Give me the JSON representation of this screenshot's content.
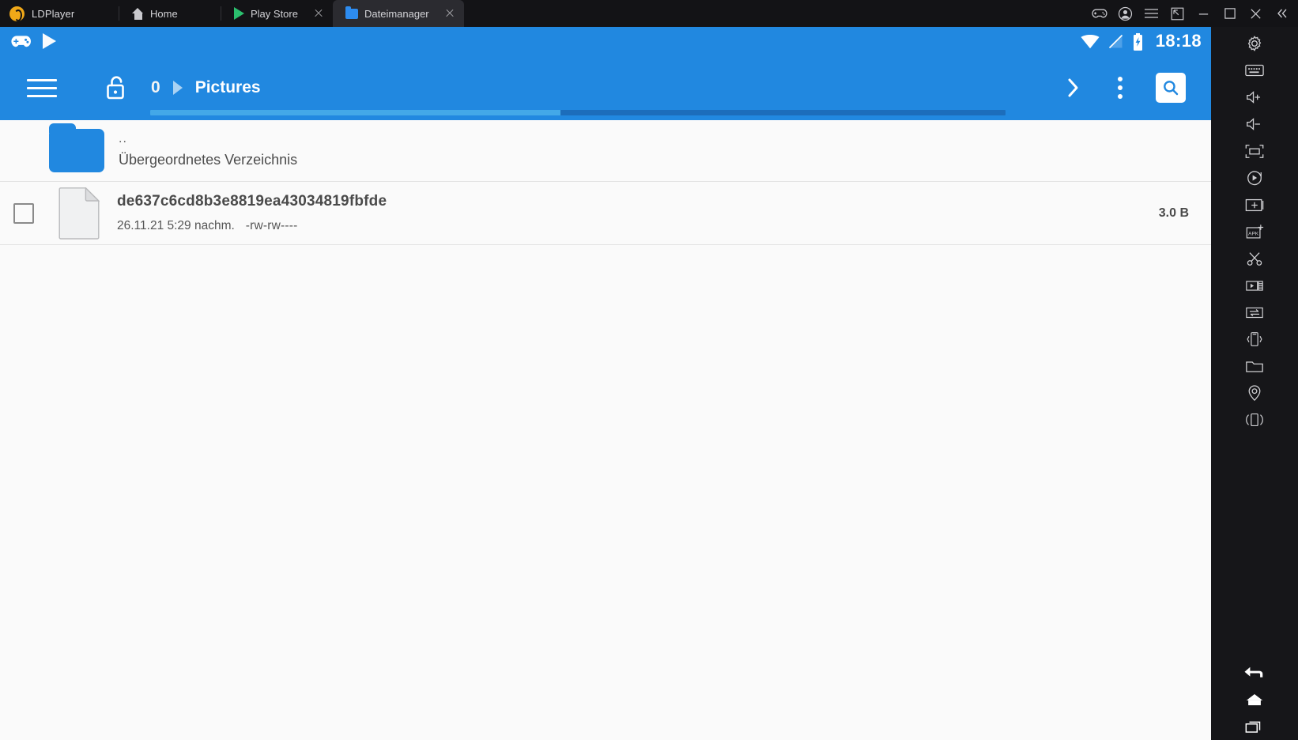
{
  "titlebar": {
    "brand": "LDPlayer",
    "tabs": [
      {
        "label": "Home",
        "icon": "home-icon",
        "closable": false,
        "active": false
      },
      {
        "label": "Play Store",
        "icon": "play-store-icon",
        "closable": true,
        "active": false
      },
      {
        "label": "Dateimanager",
        "icon": "file-manager-icon",
        "closable": true,
        "active": true
      }
    ],
    "controls": [
      {
        "name": "gamepad-icon",
        "label": "Gamepad"
      },
      {
        "name": "account-icon",
        "label": "Account"
      },
      {
        "name": "menu-icon",
        "label": "Menu"
      },
      {
        "name": "resize-icon",
        "label": "Resize"
      },
      {
        "name": "minimize-icon",
        "label": "Minimize"
      },
      {
        "name": "maximize-icon",
        "label": "Maximize"
      },
      {
        "name": "close-icon",
        "label": "Close"
      },
      {
        "name": "collapse-icon",
        "label": "Collapse"
      }
    ]
  },
  "statusbar": {
    "time": "18:18",
    "left_icons": [
      "gamepad-icon",
      "play-store-icon"
    ],
    "right_icons": [
      "wifi-icon",
      "no-signal-icon",
      "battery-charging-icon"
    ]
  },
  "appbar": {
    "menu_label": "Menu",
    "lock_label": "Unlock",
    "breadcrumbs": [
      {
        "label": "0"
      },
      {
        "label": "Pictures"
      }
    ],
    "actions": [
      {
        "name": "chevron-right-icon",
        "label": "Forward"
      },
      {
        "name": "overflow-menu-icon",
        "label": "More options"
      },
      {
        "name": "search-icon",
        "label": "Search"
      }
    ],
    "progress_percent": 48,
    "accent_color": "#2188e0",
    "progress_track_color": "#1c6dbb",
    "progress_fill_color": "#43a8e8"
  },
  "list": {
    "parent_row": {
      "title": "..",
      "subtitle": "Übergeordnetes Verzeichnis"
    },
    "files": [
      {
        "name": "de637c6cd8b3e8819ea43034819fbfde",
        "date": "26.11.21 5:29 nachm.",
        "permissions": "-rw-rw----",
        "size": "3.0 B",
        "selected": false
      }
    ]
  },
  "sidebar": {
    "items": [
      {
        "name": "settings-gear-icon",
        "label": "Settings"
      },
      {
        "name": "keyboard-icon",
        "label": "Keyboard"
      },
      {
        "name": "volume-up-icon",
        "label": "Volume up"
      },
      {
        "name": "volume-down-icon",
        "label": "Volume down"
      },
      {
        "name": "fullscreen-icon",
        "label": "Fullscreen"
      },
      {
        "name": "rotate-icon",
        "label": "Rotate"
      },
      {
        "name": "add-screen-icon",
        "label": "Add screen"
      },
      {
        "name": "install-apk-icon",
        "label": "Install APK"
      },
      {
        "name": "scissors-icon",
        "label": "Screenshot"
      },
      {
        "name": "video-record-icon",
        "label": "Record"
      },
      {
        "name": "file-transfer-icon",
        "label": "File transfer"
      },
      {
        "name": "shake-icon",
        "label": "Shake"
      },
      {
        "name": "folder-icon",
        "label": "Shared folder"
      },
      {
        "name": "location-icon",
        "label": "Location"
      },
      {
        "name": "multi-instance-icon",
        "label": "Multi instance"
      }
    ],
    "nav": [
      {
        "name": "back-icon",
        "label": "Back"
      },
      {
        "name": "home-icon",
        "label": "Home"
      },
      {
        "name": "recents-icon",
        "label": "Recents"
      }
    ]
  }
}
